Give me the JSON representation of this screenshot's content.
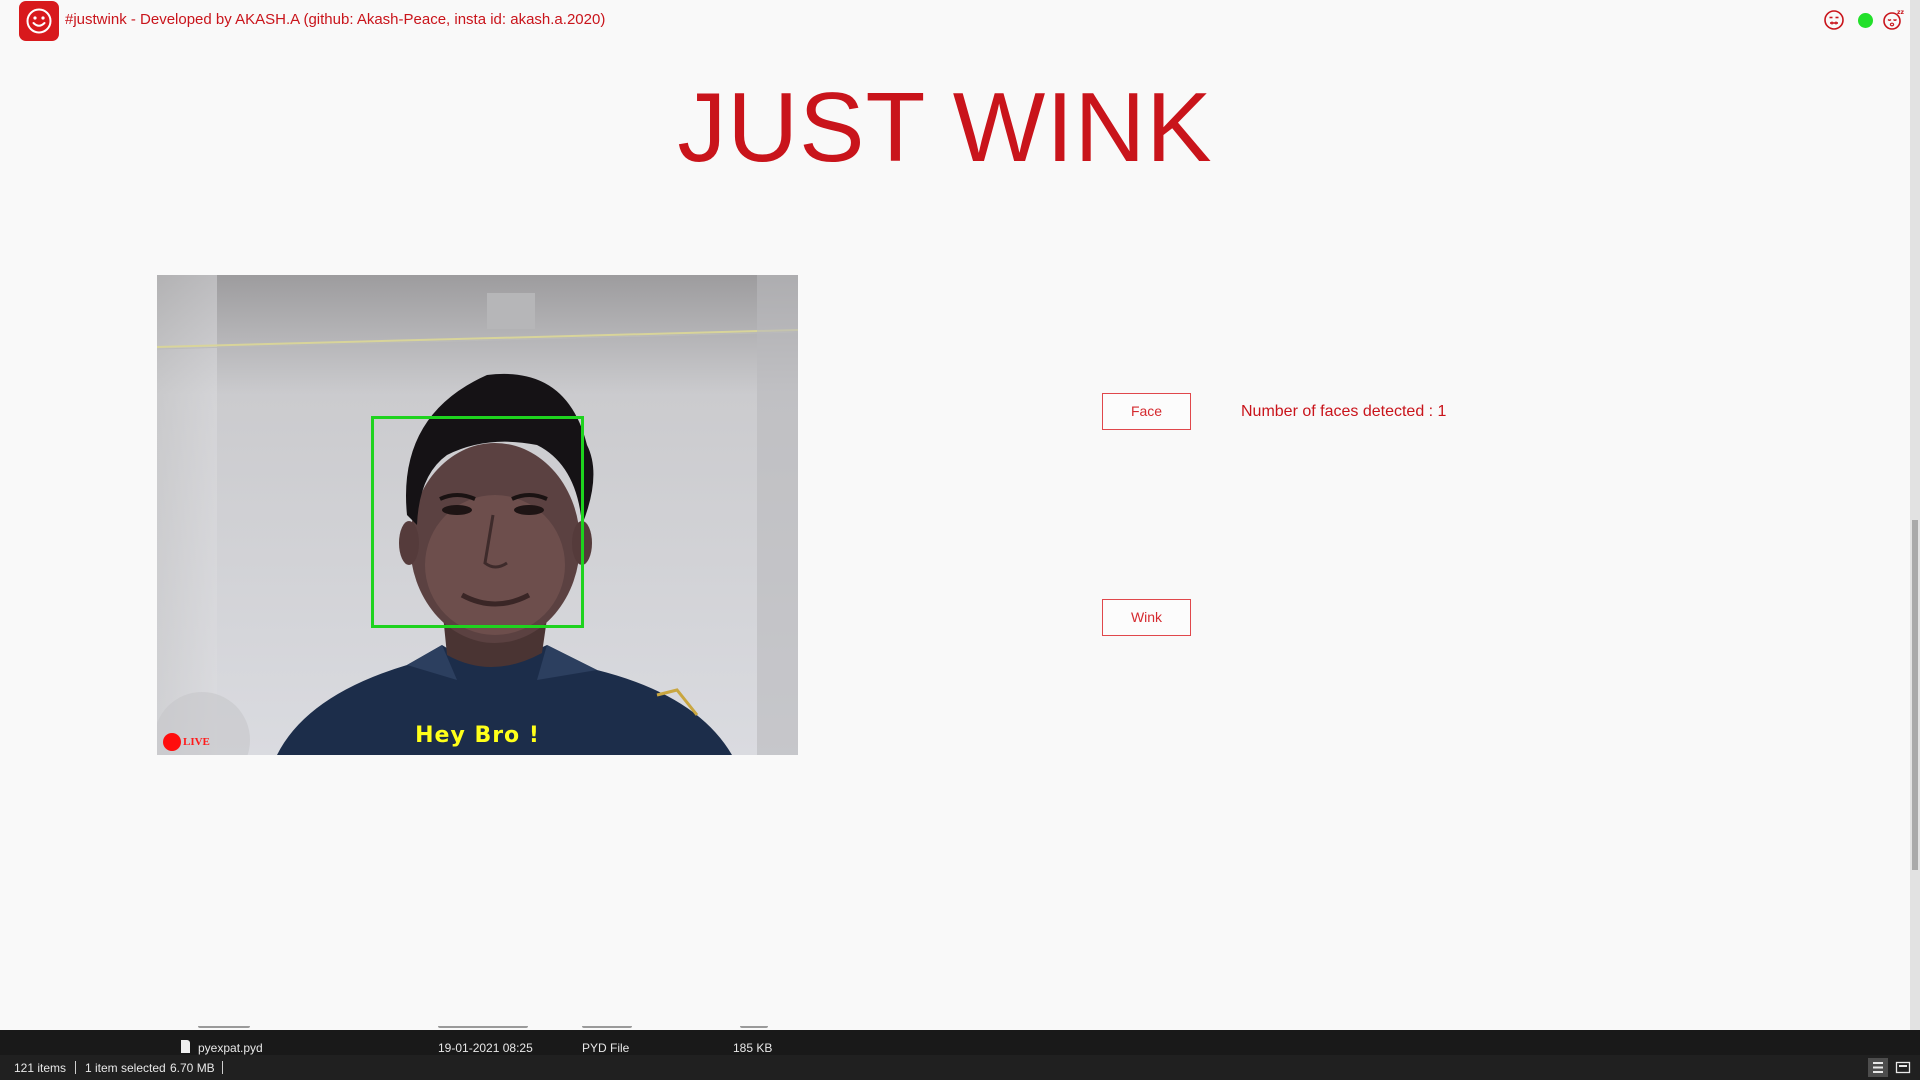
{
  "window": {
    "title": "#justwink - Developed by AKASH.A (github: Akash-Peace, insta id: akash.a.2020)",
    "controls": [
      "minimize-face-icon",
      "green-dot-icon",
      "sleeping-face-icon"
    ]
  },
  "app": {
    "heading": "JUST WINK",
    "camera": {
      "live_label": "LIVE",
      "greeting": "Hey Bro !"
    },
    "face_button": "Face",
    "wink_button": "Wink",
    "faces_detected": "Number of faces detected : 1"
  },
  "explorer": {
    "file": {
      "name": "pyexpat.pyd",
      "date": "19-01-2021 08:25",
      "type": "PYD File",
      "size": "185 KB"
    },
    "status": {
      "items": "121 items",
      "selected": "1 item selected",
      "selected_size": "6.70 MB"
    }
  },
  "colors": {
    "accent": "#c9141b",
    "face_box": "#1ed31e",
    "greeting": "#ffff1a",
    "live_dot": "#ff0d0d",
    "status_green": "#22e02a"
  }
}
